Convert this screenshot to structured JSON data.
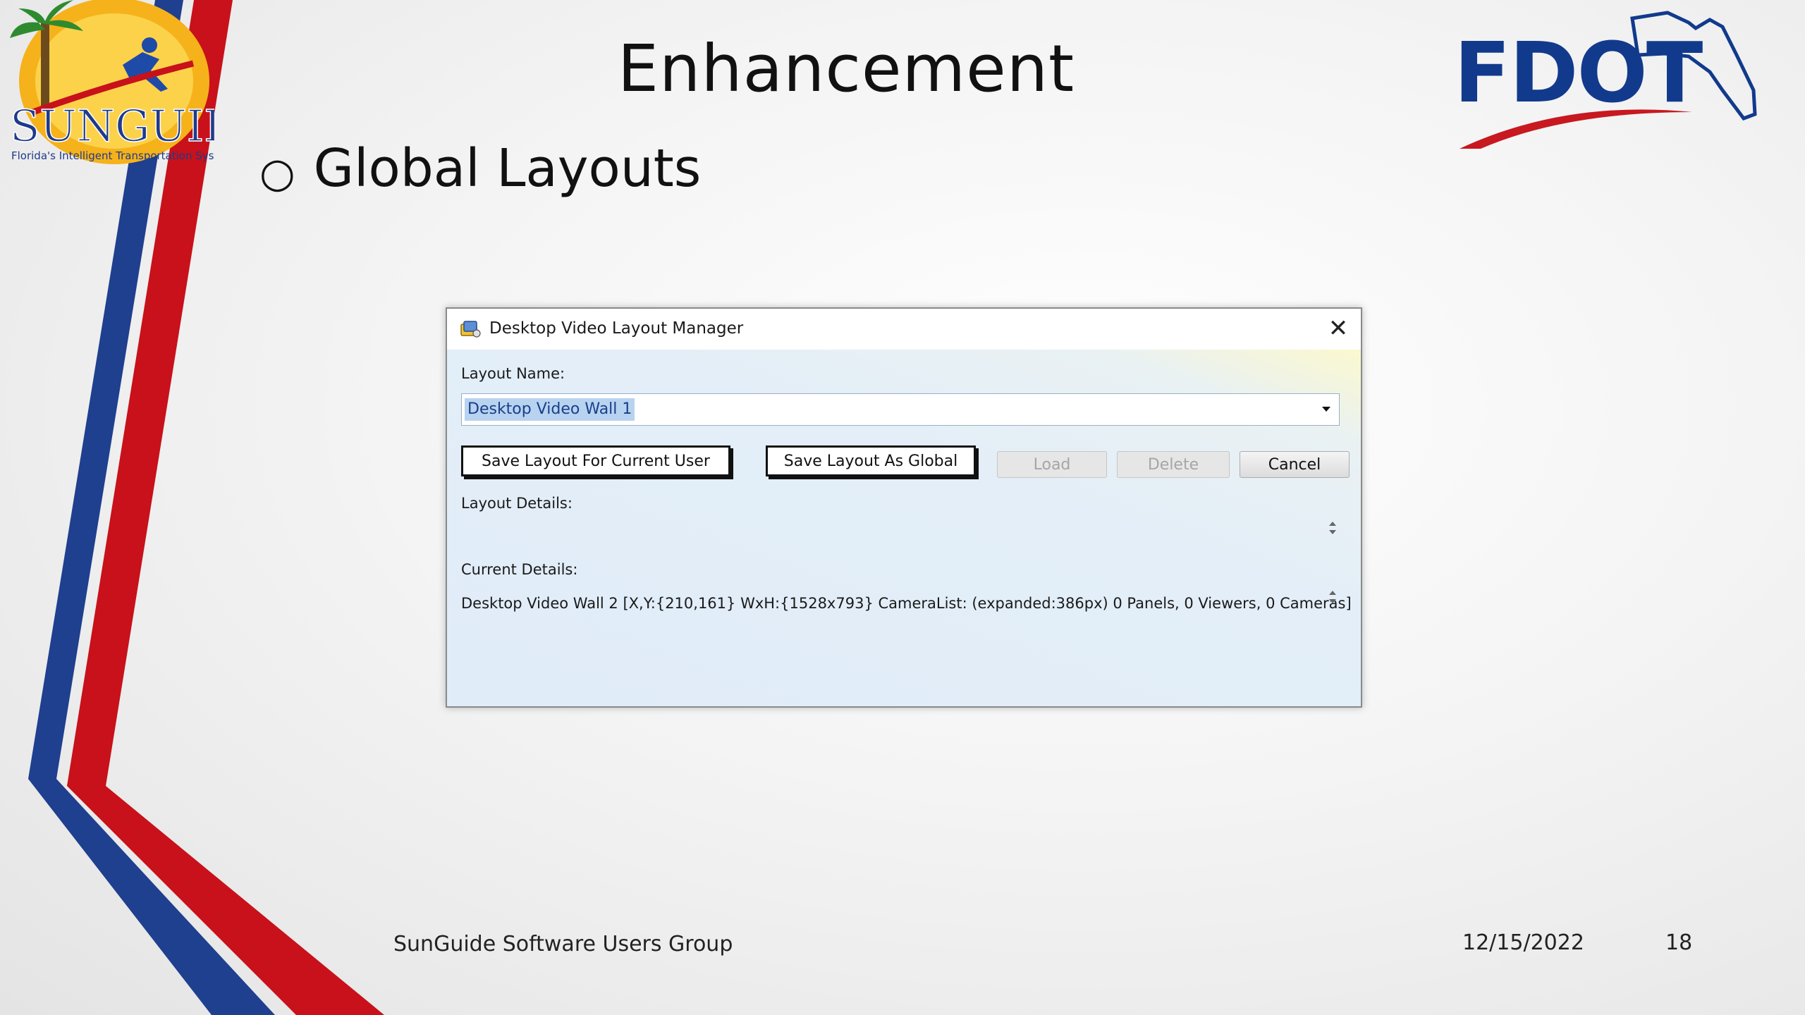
{
  "slide": {
    "title": "Enhancement",
    "bullet_mark": "○",
    "bullet_text": "Global Layouts"
  },
  "logos": {
    "sunguide_text": "SUNGUIDE",
    "sunguide_tagline": "Florida's Intelligent Transportation System",
    "fdot_text": "FDOT"
  },
  "dialog": {
    "title": "Desktop Video Layout Manager",
    "close_glyph": "✕",
    "layout_name_label": "Layout Name:",
    "layout_name_value": "Desktop Video Wall 1",
    "buttons": {
      "save_user": "Save Layout For Current User",
      "save_global": "Save Layout As Global",
      "load": "Load",
      "delete": "Delete",
      "cancel": "Cancel"
    },
    "layout_details_label": "Layout Details:",
    "current_details_label": "Current Details:",
    "current_details_value": "Desktop Video Wall 2 [X,Y:{210,161} WxH:{1528x793} CameraList: (expanded:386px) 0 Panels, 0 Viewers, 0 Cameras]"
  },
  "footer": {
    "group": "SunGuide Software Users Group",
    "date": "12/15/2022",
    "page": "18"
  },
  "colors": {
    "stripe_blue": "#1f3f8f",
    "stripe_red": "#c8111a",
    "fdot_blue": "#123a8c",
    "fdot_red": "#c81820",
    "selection": "#b8d3f0"
  }
}
